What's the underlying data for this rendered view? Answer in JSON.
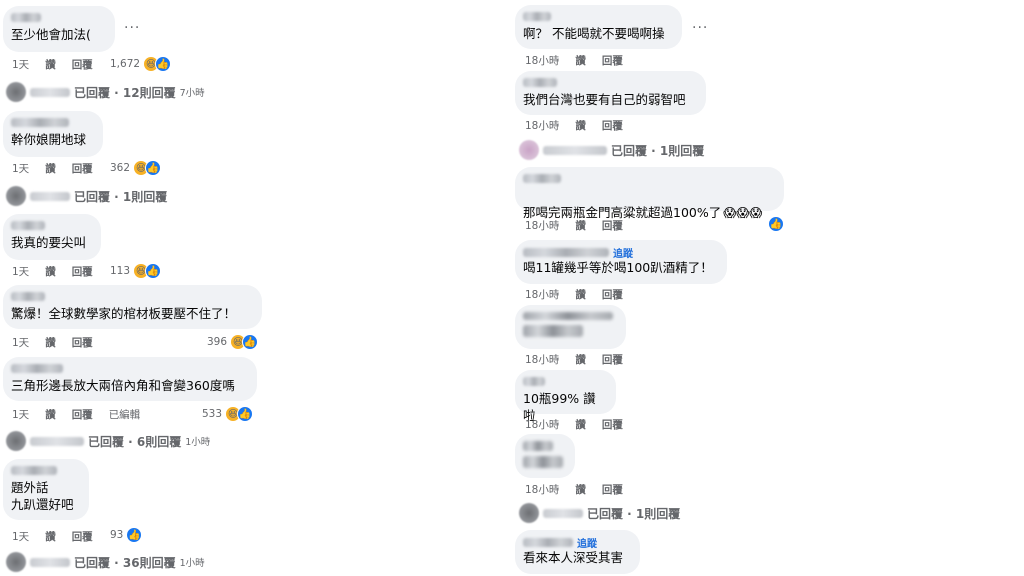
{
  "left": {
    "comments": [
      {
        "text": "至少他會加法(",
        "time": "1天",
        "like": "讚",
        "reply": "回覆",
        "count": "1,672",
        "reactions": [
          "haha",
          "like"
        ],
        "replies": "已回覆 · 12則回覆",
        "replies_ago": "7小時"
      },
      {
        "text": "幹你娘開地球",
        "time": "1天",
        "like": "讚",
        "reply": "回覆",
        "count": "362",
        "reactions": [
          "haha",
          "like"
        ],
        "replies": "已回覆 · 1則回覆",
        "replies_ago": ""
      },
      {
        "text": "我真的要尖叫",
        "time": "1天",
        "like": "讚",
        "reply": "回覆",
        "count": "113",
        "reactions": [
          "haha",
          "like"
        ]
      },
      {
        "text": "驚爆！全球數學家的棺材板要壓不住了！",
        "time": "1天",
        "like": "讚",
        "reply": "回覆",
        "count": "396",
        "reactions": [
          "haha",
          "like"
        ]
      },
      {
        "text": "三角形邊長放大兩倍內角和會變360度嗎",
        "time": "1天",
        "like": "讚",
        "reply": "回覆",
        "edited": "已編輯",
        "count": "533",
        "reactions": [
          "haha",
          "like"
        ],
        "replies": "已回覆 · 6則回覆",
        "replies_ago": "1小時"
      },
      {
        "text": "題外話\n九趴還好吧",
        "time": "1天",
        "like": "讚",
        "reply": "回覆",
        "count": "93",
        "reactions": [
          "like"
        ],
        "replies": "已回覆 · 36則回覆",
        "replies_ago": "1小時"
      }
    ]
  },
  "right": {
    "comments": [
      {
        "text": "啊？ 不能喝就不要喝啊操",
        "time": "18小時",
        "like": "讚",
        "reply": "回覆"
      },
      {
        "text": "我們台灣也要有自己的弱智吧",
        "time": "18小時",
        "like": "讚",
        "reply": "回覆",
        "replies": "已回覆 · 1則回覆"
      },
      {
        "text": "那喝完兩瓶金門高粱就超過100%了",
        "time": "18小時",
        "like": "讚",
        "reply": "回覆",
        "reactions": [
          "wow3",
          "like"
        ]
      },
      {
        "text": "喝11罐幾乎等於喝100趴酒精了！",
        "follow": "追蹤",
        "time": "18小時",
        "like": "讚",
        "reply": "回覆"
      },
      {
        "text": "",
        "time": "18小時",
        "like": "讚",
        "reply": "回覆"
      },
      {
        "text": "10瓶99% 讚啦",
        "time": "18小時",
        "like": "讚",
        "reply": "回覆"
      },
      {
        "text": "",
        "time": "18小時",
        "like": "讚",
        "reply": "回覆",
        "replies": "已回覆 · 1則回覆"
      },
      {
        "text": "看來本人深受其害",
        "follow": "追蹤"
      }
    ]
  },
  "icons": {
    "more": "more-options-icon",
    "haha": "haha-reaction-icon",
    "like": "like-reaction-icon",
    "wow": "wow-reaction-icon"
  },
  "colors": {
    "bubble": "#f0f2f5",
    "meta": "#65676b",
    "follow": "#216fdb",
    "like": "#1877f2",
    "haha": "#f7b125"
  }
}
